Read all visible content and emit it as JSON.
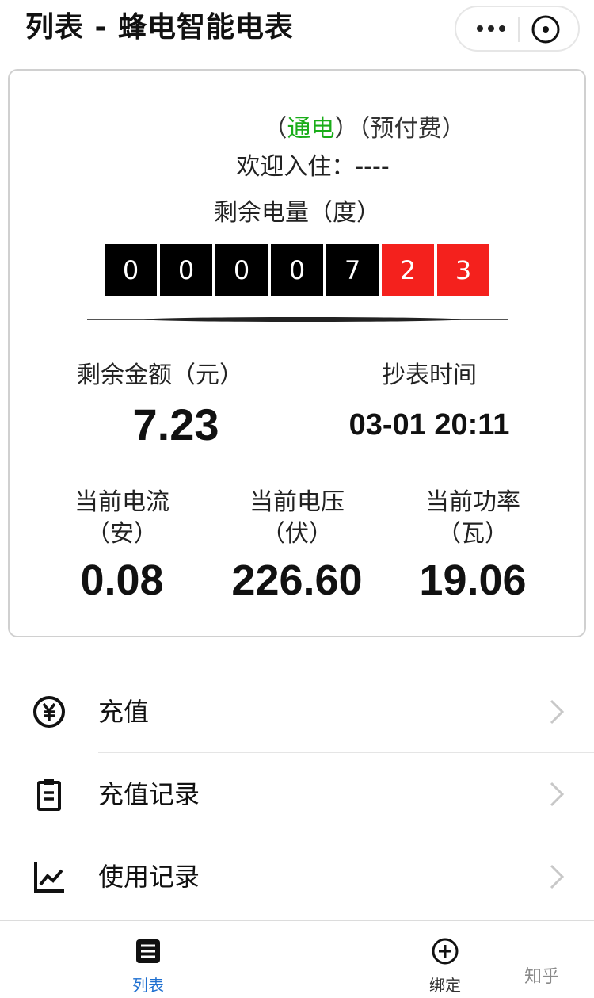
{
  "header": {
    "title": "列表 - 蜂电智能电表",
    "more_icon": "more-dots-icon",
    "close_icon": "close-circle-icon"
  },
  "meter": {
    "status_open": "（",
    "power_status": "通电",
    "status_close": "）",
    "payment_mode": "（预付费）",
    "welcome_label": "欢迎入住：",
    "welcome_value": "----",
    "remaining_energy_label": "剩余电量（度）",
    "digits": [
      "0",
      "0",
      "0",
      "0",
      "7",
      "2",
      "3"
    ],
    "remaining_amount_label": "剩余金额（元）",
    "remaining_amount": "7.23",
    "read_time_label": "抄表时间",
    "read_time": "03-01 20:11",
    "current_label": "当前电流",
    "current_unit": "（安）",
    "current_value": "0.08",
    "voltage_label": "当前电压",
    "voltage_unit": "（伏）",
    "voltage_value": "226.60",
    "power_label": "当前功率",
    "power_unit": "（瓦）",
    "power_value": "19.06",
    "colors": {
      "status_green": "#1aad19",
      "decimal_red": "#f4211d"
    }
  },
  "menu": [
    {
      "label": "充值",
      "icon": "yen-circle-icon"
    },
    {
      "label": "充值记录",
      "icon": "clipboard-icon"
    },
    {
      "label": "使用记录",
      "icon": "line-chart-icon"
    }
  ],
  "tabbar": {
    "tabs": [
      {
        "label": "列表",
        "icon": "list-icon",
        "active": true
      },
      {
        "label": "绑定",
        "icon": "plus-circle-icon",
        "active": false
      }
    ],
    "active_color": "#1e6fd0"
  },
  "watermark": "知乎"
}
